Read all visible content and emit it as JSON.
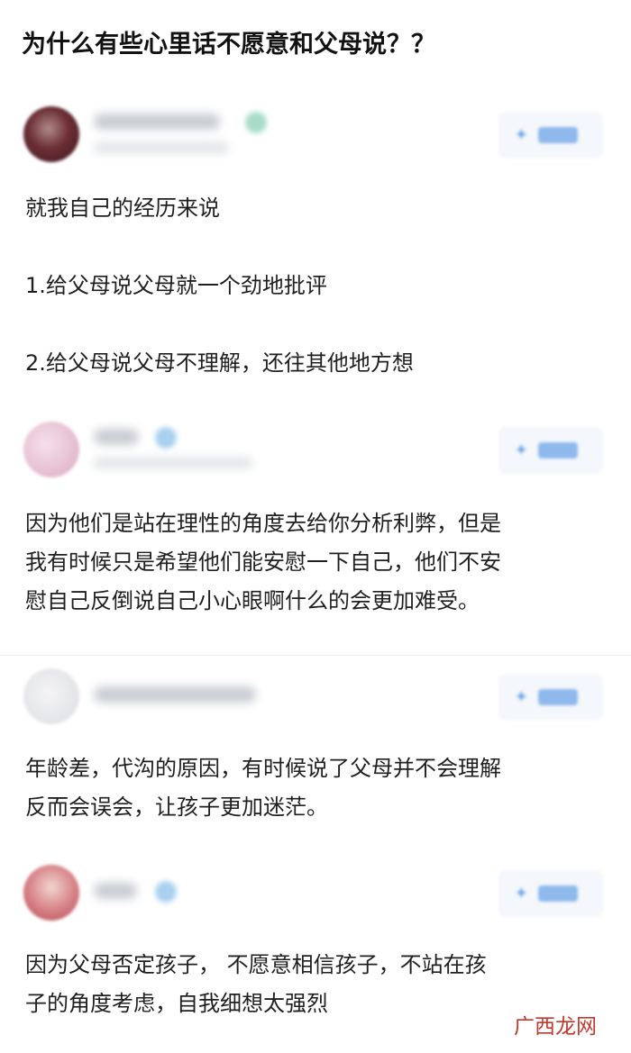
{
  "question": {
    "title": "为什么有些心里话不愿意和父母说？？"
  },
  "answers": [
    {
      "paragraphs": [
        "就我自己的经历来说",
        "1.给父母说父母就一个劲地批评",
        "2.给父母说父母不理解，还往其他地方想"
      ],
      "avatar_color": "#6b2e35"
    },
    {
      "paragraphs": [
        "因为他们是站在理性的角度去给你分析利弊，但是\n我有时候只是希望他们能安慰一下自己，他们不安\n慰自己反倒说自己小心眼啊什么的会更加难受。"
      ],
      "avatar_color": "#e7c3d3"
    },
    {
      "paragraphs": [
        "年龄差，代沟的原因，有时候说了父母并不会理解\n反而会误会，让孩子更加迷茫。"
      ],
      "avatar_color": "#e3e4e7"
    },
    {
      "paragraphs": [
        "因为父母否定孩子， 不愿意相信孩子，不站在孩\n子的角度考虑，自我细想太强烈"
      ],
      "avatar_color": "#d9868a"
    }
  ],
  "watermark": "广西龙网",
  "colors": {
    "follow_button_bg": "#f4f7fb",
    "follow_button_accent": "#4a8fe2",
    "watermark": "#c0392b"
  },
  "icons": {
    "verified": "verified-badge-icon",
    "follow": "plus-icon"
  }
}
